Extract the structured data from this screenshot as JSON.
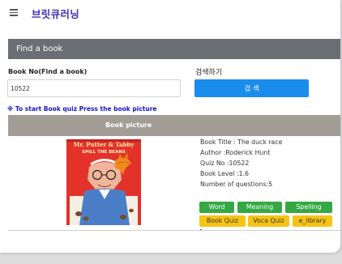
{
  "header": {
    "brand": "브릿큐러닝"
  },
  "card": {
    "title": "Find a book"
  },
  "search": {
    "label": "Book No(Find a book)",
    "value": "10522",
    "action_label": "검색하기",
    "button_label": "검 색"
  },
  "notice": "※ To start Book quiz Press the book picture",
  "table": {
    "column_picture": "Book picture"
  },
  "book": {
    "cover": {
      "line1": "Mr. Putter & Tabby",
      "line2": "SPILL THE BEANS"
    },
    "details": [
      "Book Title : The duck race",
      "Author :Roderick Hunt",
      "Quiz No :10522",
      "Book Level :1.6",
      "Number of questions:5"
    ]
  },
  "buttons": {
    "word": "Word",
    "meaning": "Meaning",
    "spelling": "Spelling",
    "book_quiz": "Book Quiz",
    "voca_quiz": "Voca Quiz",
    "e_library": "e_library"
  },
  "colors": {
    "brand": "#3a31b5",
    "header_bar": "#6b6e72",
    "table_header": "#a29d97",
    "search_button": "#1a8ceb",
    "notice": "#1515c8",
    "green_button": "#35a844",
    "yellow_button": "#f7c414"
  }
}
